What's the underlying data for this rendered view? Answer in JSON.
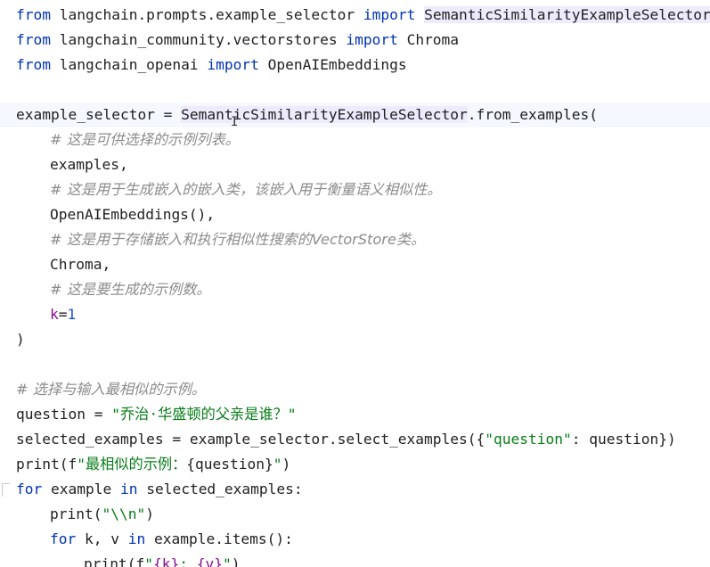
{
  "code": {
    "l1": {
      "kw1": "from",
      "mod": " langchain.prompts.example_selector ",
      "kw2": "import",
      "sp": " ",
      "cls": "SemanticSimilarityExampleSelector"
    },
    "l2": {
      "kw1": "from",
      "mod": " langchain_community.vectorstores ",
      "kw2": "import",
      "name": " Chroma"
    },
    "l3": {
      "kw1": "from",
      "mod": " langchain_openai ",
      "kw2": "import",
      "name": " OpenAIEmbeddings"
    },
    "l5": {
      "lhs": "example_selector = ",
      "cls": "SemanticSimilarityExampleSelector",
      "rest": ".from_examples("
    },
    "l6": {
      "comment": "# 这是可供选择的示例列表。"
    },
    "l7": {
      "text": "examples,"
    },
    "l8": {
      "comment": "# 这是用于生成嵌入的嵌入类，该嵌入用于衡量语义相似性。"
    },
    "l9": {
      "text": "OpenAIEmbeddings(),"
    },
    "l10": {
      "comment": "# 这是用于存储嵌入和执行相似性搜索的VectorStore类。"
    },
    "l11": {
      "text": "Chroma,"
    },
    "l12": {
      "comment": "# 这是要生成的示例数。"
    },
    "l13": {
      "param": "k",
      "eq": "=",
      "num": "1"
    },
    "l14": {
      "text": ")"
    },
    "l16": {
      "comment": "# 选择与输入最相似的示例。"
    },
    "l17": {
      "lhs": "question = ",
      "str": "\"乔治·华盛顿的父亲是谁？\""
    },
    "l18": {
      "a": "selected_examples = example_selector.select_examples({",
      "str": "\"question\"",
      "b": ": question})"
    },
    "l19": {
      "a": "print(f",
      "str1": "\"最相似的示例：",
      "b": "{question}",
      "str2": "\"",
      "c": ")"
    },
    "l20": {
      "kw1": "for",
      "a": " example ",
      "kw2": "in",
      "b": " selected_examples:"
    },
    "l21": {
      "a": "print(",
      "str": "\"\\\\n\"",
      "b": ")"
    },
    "l22": {
      "kw1": "for",
      "a": " k, v ",
      "kw2": "in",
      "b": " example.items():"
    },
    "l23": {
      "a": "print(f",
      "str1": "\"",
      "b": "{k}",
      "str2": ": ",
      "c": "{v}",
      "str3": "\"",
      "d": ")"
    }
  },
  "colors": {
    "keyword": "#0033b3",
    "comment": "#8c8c8c",
    "string": "#067d17",
    "param": "#871094",
    "number": "#1750eb",
    "highlight": "#edebfc"
  },
  "cursor_glyph": "I"
}
